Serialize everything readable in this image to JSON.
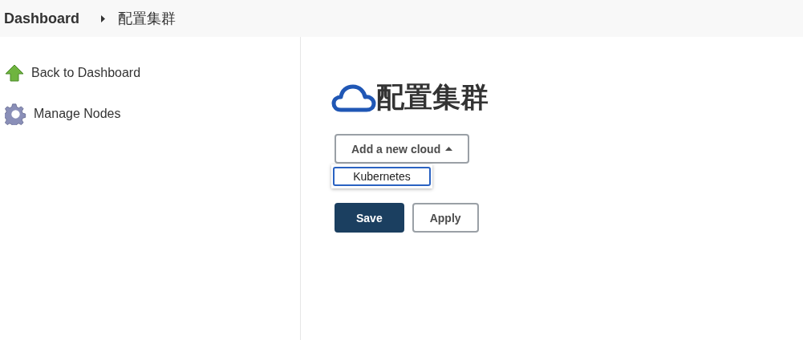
{
  "breadcrumbs": [
    {
      "label": "Dashboard"
    },
    {
      "label": "配置集群"
    }
  ],
  "sidebar": {
    "items": [
      {
        "label": "Back to Dashboard",
        "kind": "back"
      },
      {
        "label": "Manage Nodes",
        "kind": "nodes"
      }
    ]
  },
  "main": {
    "heading": "配置集群",
    "add_cloud": {
      "label": "Add a new cloud",
      "expanded": true
    },
    "menu": [
      {
        "label": "Kubernetes",
        "selected": true
      }
    ],
    "buttons": [
      {
        "label": "Save",
        "kind": "primary"
      },
      {
        "label": "Apply",
        "kind": "secondary"
      }
    ]
  }
}
